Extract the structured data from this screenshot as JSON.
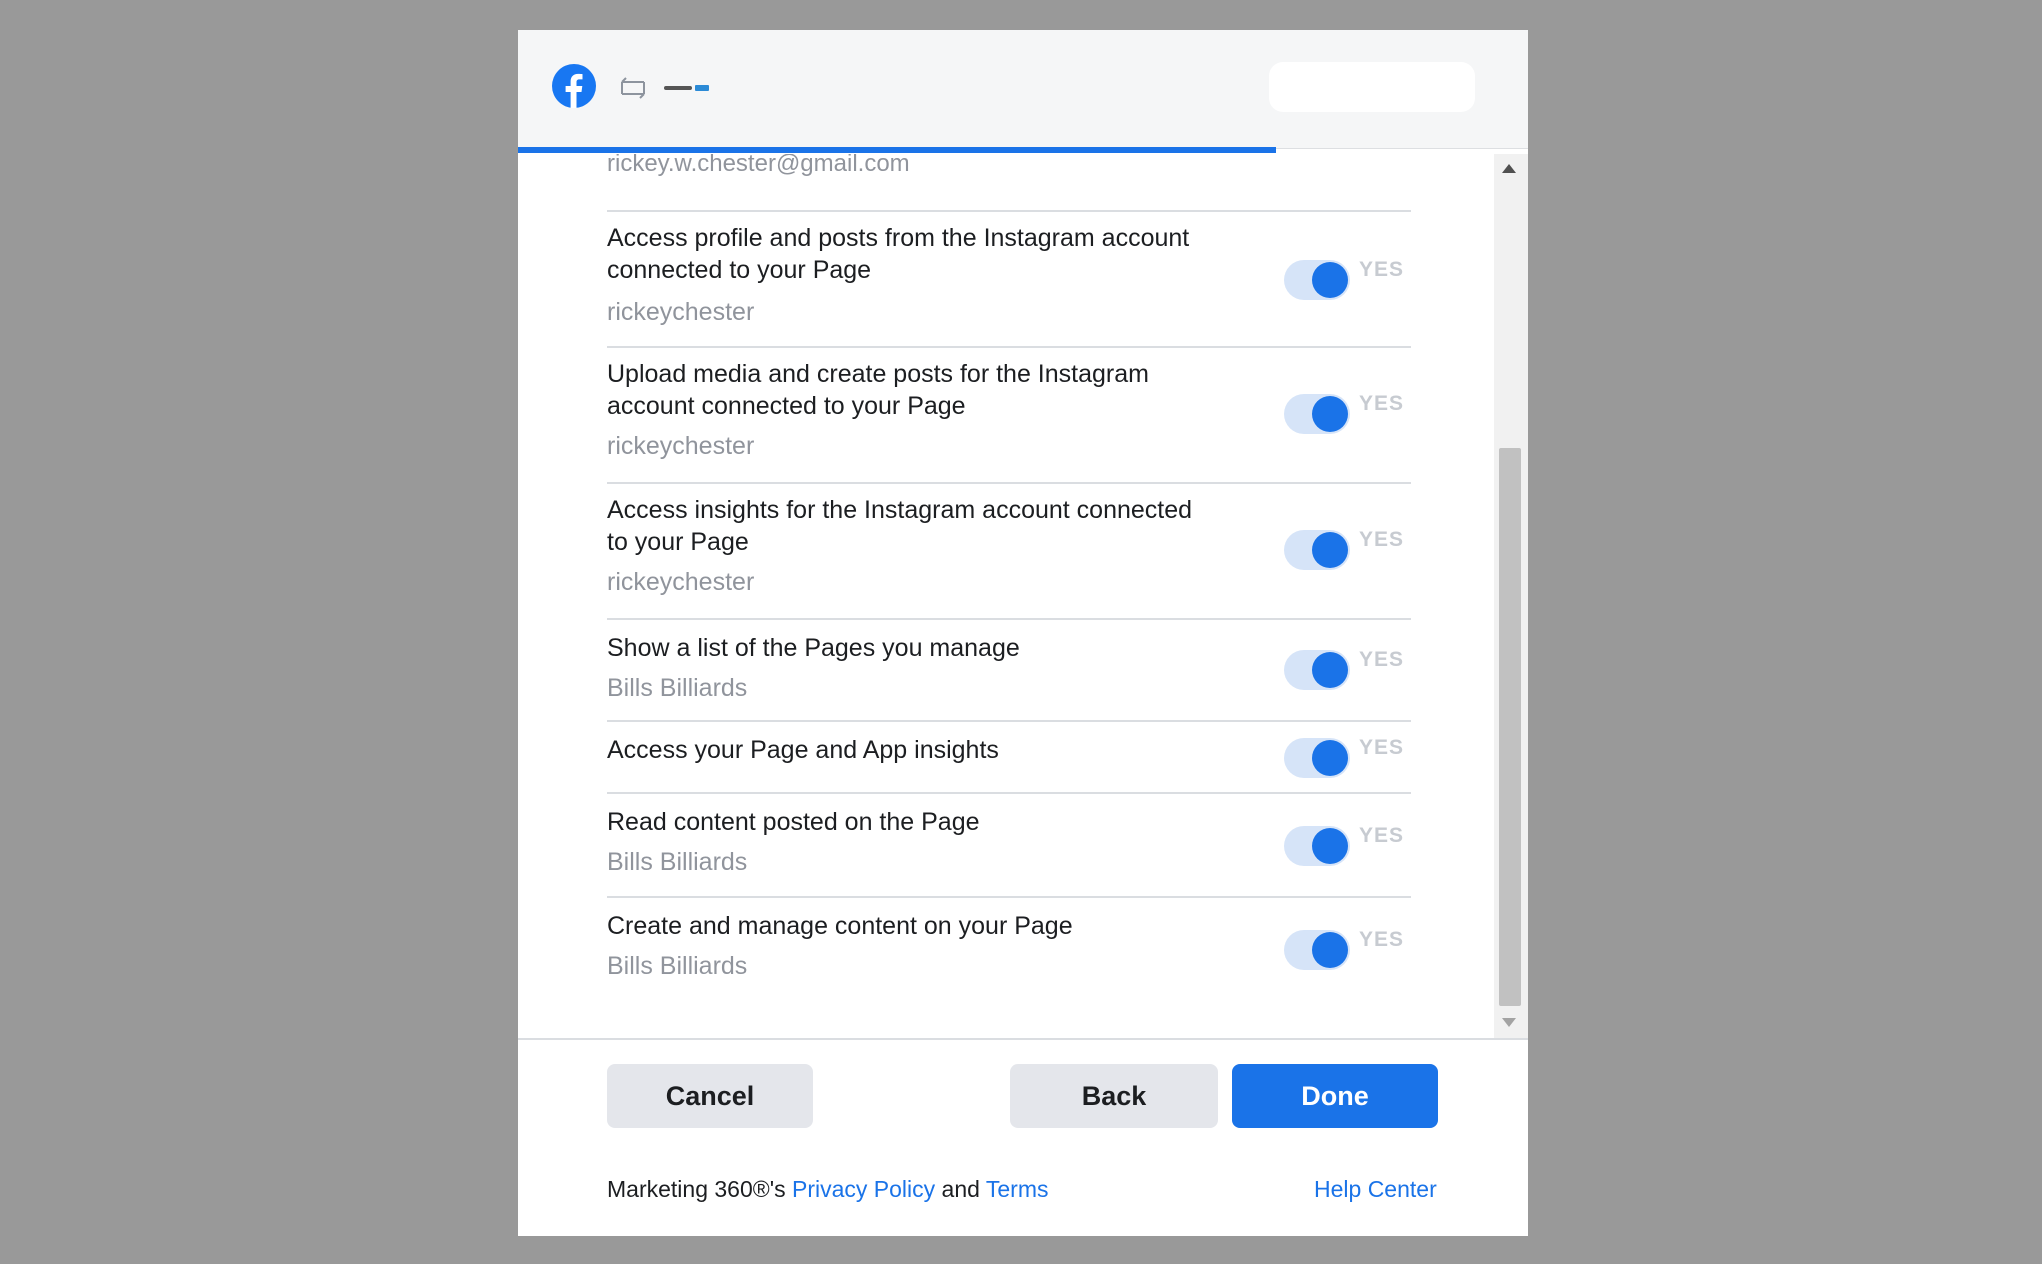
{
  "header": {
    "logo_icon": "facebook-icon",
    "swap_icon": "swap-icon",
    "app_logo": "marketing-360-logo"
  },
  "partial_email": "rickey.w.chester@gmail.com",
  "permissions": [
    {
      "title": "Access profile and posts from the Instagram account connected to your Page",
      "sub": "rickeychester",
      "state": "YES"
    },
    {
      "title": "Upload media and create posts for the Instagram account connected to your Page",
      "sub": "rickeychester",
      "state": "YES"
    },
    {
      "title": "Access insights for the Instagram account connected to your Page",
      "sub": "rickeychester",
      "state": "YES"
    },
    {
      "title": "Show a list of the Pages you manage",
      "sub": "Bills Billiards",
      "state": "YES"
    },
    {
      "title": "Access your Page and App insights",
      "sub": "",
      "state": "YES"
    },
    {
      "title": "Read content posted on the Page",
      "sub": "Bills Billiards",
      "state": "YES"
    },
    {
      "title": "Create and manage content on your Page",
      "sub": "Bills Billiards",
      "state": "YES"
    }
  ],
  "buttons": {
    "cancel": "Cancel",
    "back": "Back",
    "done": "Done"
  },
  "footer": {
    "policy_prefix": "Marketing 360®'s ",
    "privacy_policy": "Privacy Policy",
    "and": " and ",
    "terms": "Terms",
    "help_center": "Help Center"
  },
  "colors": {
    "accent": "#1a73e8",
    "backdrop": "#999999"
  },
  "progress": 0.75
}
